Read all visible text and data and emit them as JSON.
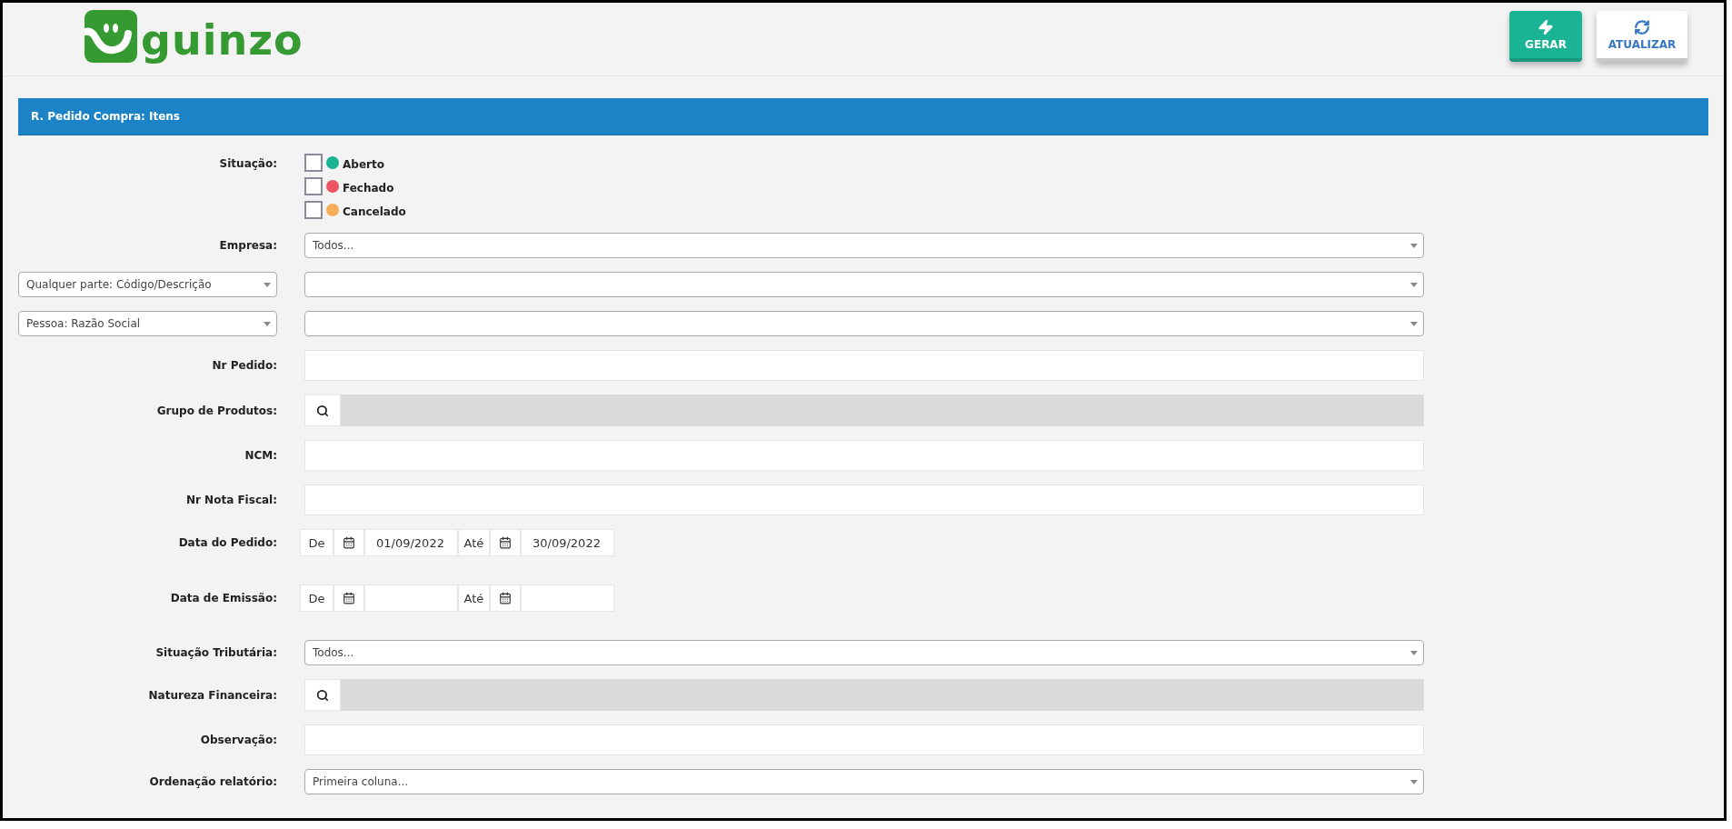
{
  "header": {
    "logo": "guinzo",
    "buttons": [
      {
        "label": "GERAR",
        "kind": "primary"
      },
      {
        "label": "ATUALIZAR",
        "kind": "secondary"
      }
    ]
  },
  "panel": {
    "title": "R. Pedido Compra: Itens"
  },
  "situacao": {
    "label": "Situação:",
    "options": [
      {
        "label": "Aberto",
        "checked": false,
        "color": "#1ab394"
      },
      {
        "label": "Fechado",
        "checked": false,
        "color": "#ed5565"
      },
      {
        "label": "Cancelado",
        "checked": false,
        "color": "#f8ac59"
      }
    ]
  },
  "fields": [
    {
      "kind": "select",
      "label": "Empresa:",
      "value": "Todos..."
    },
    {
      "kind": "select",
      "label_select": "Qualquer parte: Código/Descrição"
    },
    {
      "kind": "select",
      "label_select": "Pessoa: Razão Social"
    },
    {
      "kind": "text",
      "label": "Nr Pedido:"
    },
    {
      "kind": "lookup",
      "label": "Grupo de Produtos:"
    },
    {
      "kind": "text",
      "label": "NCM:"
    },
    {
      "kind": "text",
      "label": "Nr Nota Fiscal:"
    },
    {
      "kind": "daterange",
      "label": "Data do Pedido:",
      "from_label": "De",
      "from": "01/09/2022",
      "to_label": "Até",
      "to": "30/09/2022"
    },
    {
      "kind": "daterange",
      "label": "Data de Emissão:",
      "from_label": "De",
      "to_label": "Até"
    },
    {
      "kind": "select",
      "label": "Situação Tributária:",
      "value": "Todos..."
    },
    {
      "kind": "lookup",
      "label": "Natureza Financeira:"
    },
    {
      "kind": "text",
      "label": "Observação:"
    },
    {
      "kind": "select",
      "label": "Ordenação relatório:",
      "value": "Primeira coluna..."
    }
  ]
}
